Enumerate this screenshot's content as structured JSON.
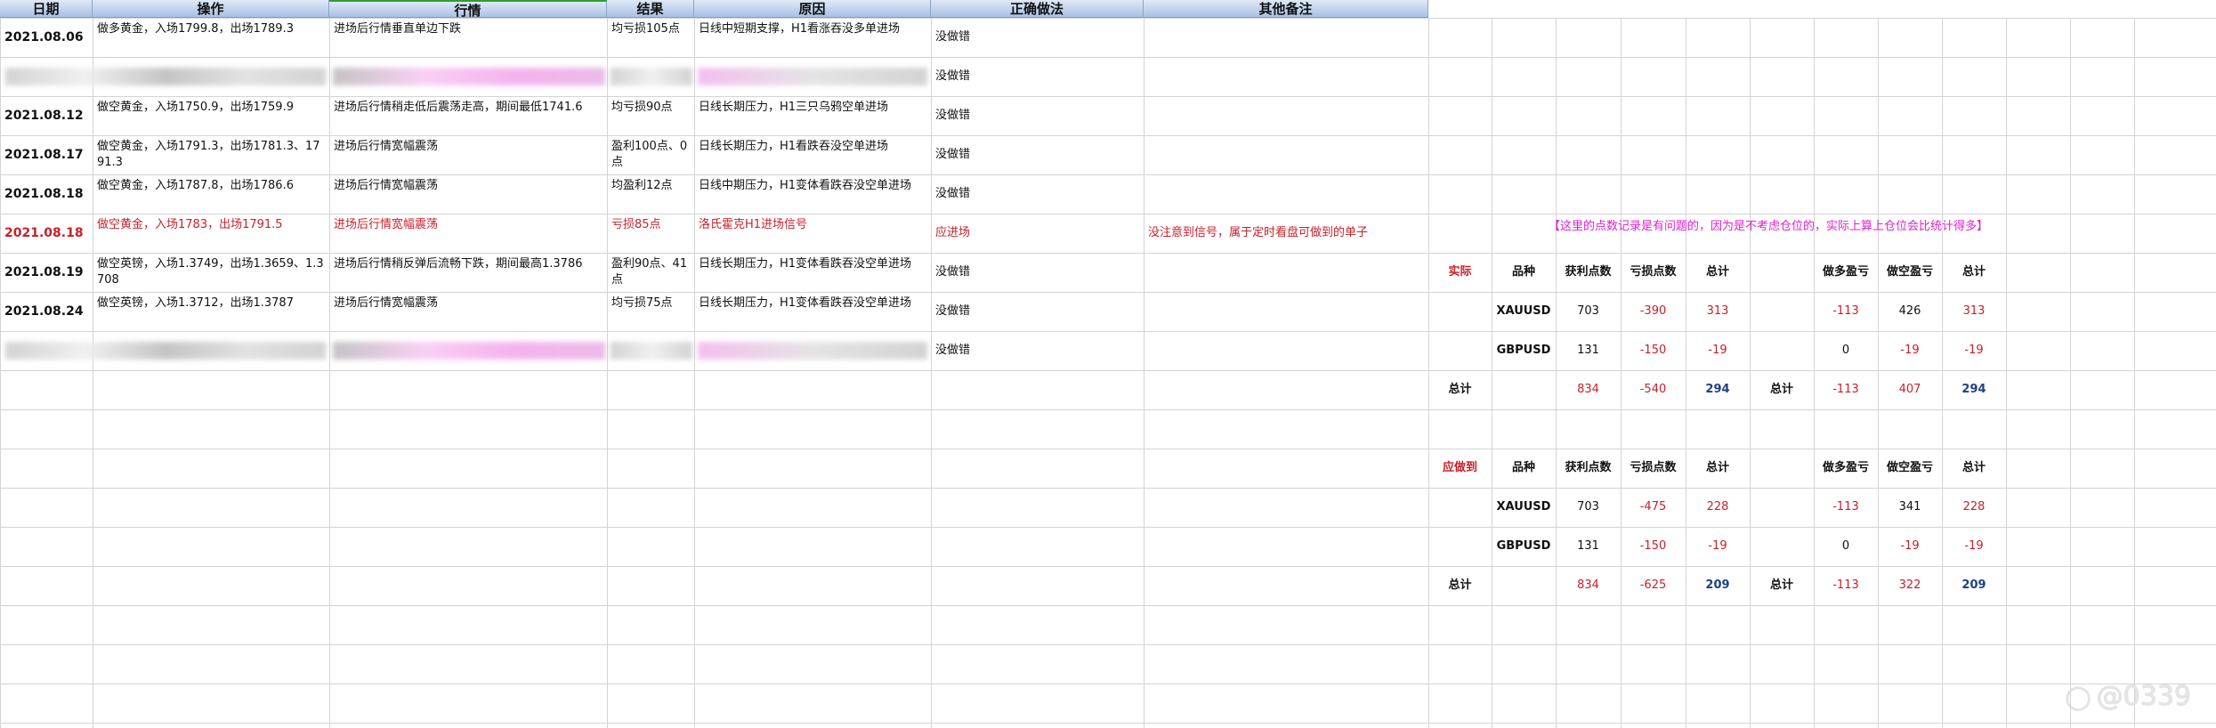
{
  "headers": [
    "日期",
    "操作",
    "行情",
    "结果",
    "原因",
    "正确做法",
    "其他备注"
  ],
  "rows": [
    {
      "date": "2021.08.06",
      "op": "做多黄金，入场1799.8，出场1789.3",
      "market": "进场后行情垂直单边下跌",
      "result": "均亏损105点",
      "reason": "日线中短期支撑，H1看涨吞没多单进场",
      "correct": "没做错",
      "note": "",
      "red": false,
      "blurred": false
    },
    {
      "date": "",
      "op": "",
      "market": "",
      "result": "",
      "reason": "",
      "correct": "没做错",
      "note": "",
      "red": false,
      "blurred": true
    },
    {
      "date": "2021.08.12",
      "op": "做空黄金，入场1750.9，出场1759.9",
      "market": "进场后行情稍走低后震荡走高，期间最低1741.6",
      "result": "均亏损90点",
      "reason": "日线长期压力，H1三只乌鸦空单进场",
      "correct": "没做错",
      "note": "",
      "red": false,
      "blurred": false
    },
    {
      "date": "2021.08.17",
      "op": "做空黄金，入场1791.3，出场1781.3、1791.3",
      "market": "进场后行情宽幅震荡",
      "result": "盈利100点、0点",
      "reason": "日线长期压力，H1看跌吞没空单进场",
      "correct": "没做错",
      "note": "",
      "red": false,
      "blurred": false
    },
    {
      "date": "2021.08.18",
      "op": "做空黄金，入场1787.8，出场1786.6",
      "market": "进场后行情宽幅震荡",
      "result": "均盈利12点",
      "reason": "日线中期压力，H1变体看跌吞没空单进场",
      "correct": "没做错",
      "note": "",
      "red": false,
      "blurred": false
    },
    {
      "date": "2021.08.18",
      "op": "做空黄金，入场1783，出场1791.5",
      "market": "进场后行情宽幅震荡",
      "result": "亏损85点",
      "reason": "洛氏霍克H1进场信号",
      "correct": "应进场",
      "note": "没注意到信号，属于定时看盘可做到的单子",
      "red": true,
      "blurred": false
    },
    {
      "date": "2021.08.19",
      "op": "做空英镑，入场1.3749，出场1.3659、1.3708",
      "market": "进场后行情稍反弹后流畅下跌，期间最高1.3786",
      "result": "盈利90点、41点",
      "reason": "日线长期压力，H1变体看跌吞没空单进场",
      "correct": "没做错",
      "note": "",
      "red": false,
      "blurred": false
    },
    {
      "date": "2021.08.24",
      "op": "做空英镑，入场1.3712，出场1.3787",
      "market": "进场后行情宽幅震荡",
      "result": "均亏损75点",
      "reason": "日线长期压力，H1变体看跌吞没空单进场",
      "correct": "没做错",
      "note": "",
      "red": false,
      "blurred": false
    },
    {
      "date": "",
      "op": "",
      "market": "",
      "result": "",
      "reason": "",
      "correct": "没做错",
      "note": "",
      "red": false,
      "blurred": true
    }
  ],
  "notice": "【这里的点数记录是有问题的，因为是不考虑仓位的，实际上算上仓位会比统计得多】",
  "summary_actual": {
    "label": "实际",
    "headers": [
      "品种",
      "获利点数",
      "亏损点数",
      "总计",
      "",
      "做多盈亏",
      "做空盈亏",
      "总计"
    ],
    "rows": [
      [
        "XAUUSD",
        "703",
        "-390",
        "313",
        "",
        "-113",
        "426",
        "313"
      ],
      [
        "GBPUSD",
        "131",
        "-150",
        "-19",
        "",
        "0",
        "-19",
        "-19"
      ]
    ],
    "total_label": "总计",
    "total": [
      "",
      "834",
      "-540",
      "294",
      "总计",
      "-113",
      "407",
      "294"
    ]
  },
  "summary_should": {
    "label": "应做到",
    "headers": [
      "品种",
      "获利点数",
      "亏损点数",
      "总计",
      "",
      "做多盈亏",
      "做空盈亏",
      "总计"
    ],
    "rows": [
      [
        "XAUUSD",
        "703",
        "-475",
        "228",
        "",
        "-113",
        "341",
        "228"
      ],
      [
        "GBPUSD",
        "131",
        "-150",
        "-19",
        "",
        "0",
        "-19",
        "-19"
      ]
    ],
    "total_label": "总计",
    "total": [
      "",
      "834",
      "-625",
      "209",
      "总计",
      "-113",
      "322",
      "209"
    ]
  },
  "watermark": "@0339",
  "watermark_icon": "weibo-icon",
  "colors": {
    "red": "#c8202a",
    "blue": "#1f3f7f",
    "magenta": "#e020d0",
    "header": "#a9c1e4"
  }
}
